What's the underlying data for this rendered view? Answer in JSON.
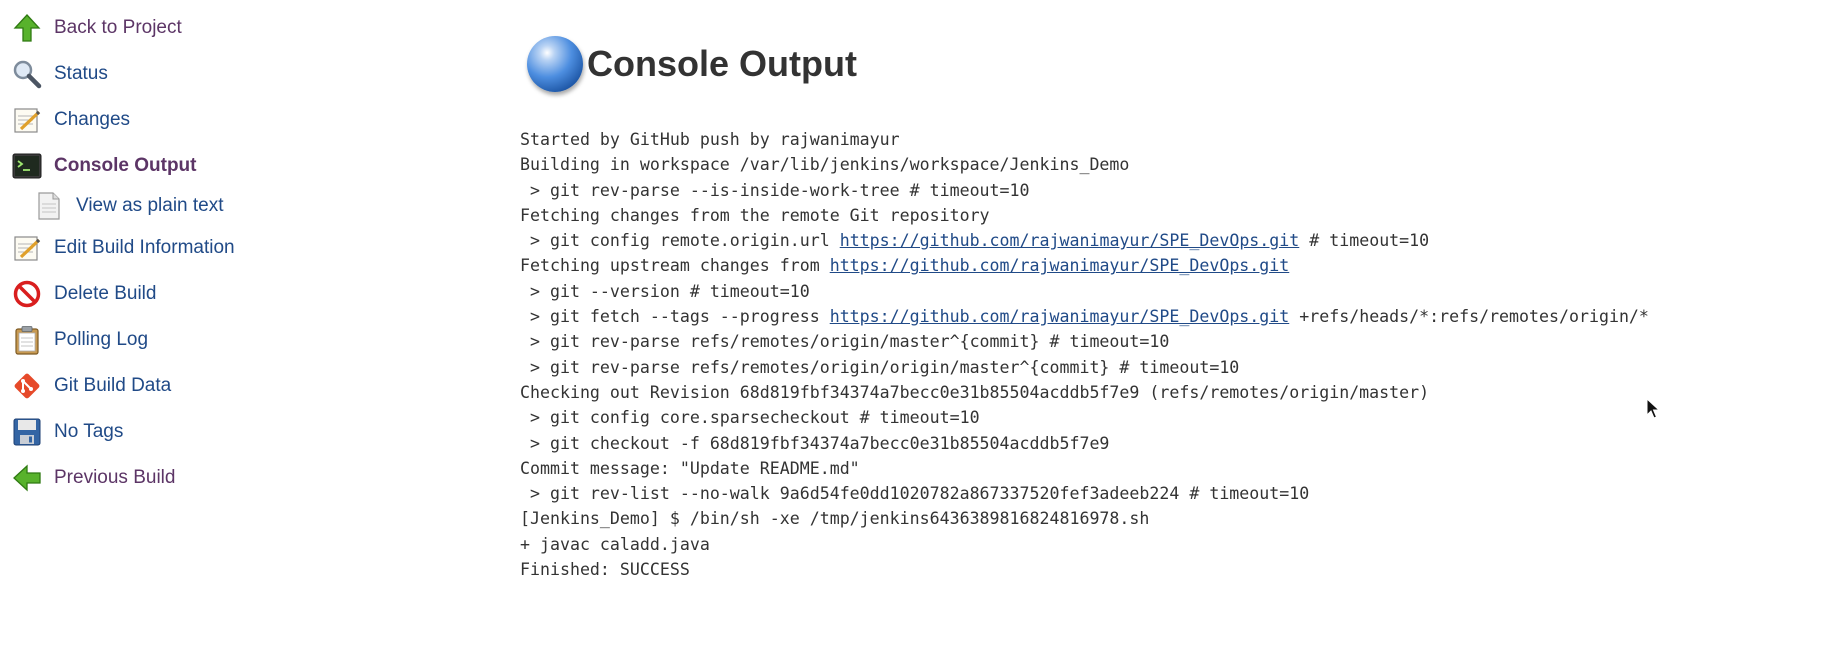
{
  "sidebar": {
    "items": [
      {
        "label": "Back to Project",
        "icon": "up-arrow-icon"
      },
      {
        "label": "Status",
        "icon": "magnifier-icon"
      },
      {
        "label": "Changes",
        "icon": "notepad-icon"
      },
      {
        "label": "Console Output",
        "icon": "terminal-icon"
      },
      {
        "label": "View as plain text",
        "icon": "document-icon"
      },
      {
        "label": "Edit Build Information",
        "icon": "notepad-pencil-icon"
      },
      {
        "label": "Delete Build",
        "icon": "no-entry-icon"
      },
      {
        "label": "Polling Log",
        "icon": "clipboard-icon"
      },
      {
        "label": "Git Build Data",
        "icon": "git-icon"
      },
      {
        "label": "No Tags",
        "icon": "floppy-disk-icon"
      },
      {
        "label": "Previous Build",
        "icon": "left-arrow-icon"
      }
    ]
  },
  "main": {
    "title": "Console Output",
    "title_icon": "globe-icon"
  },
  "console": {
    "lines": [
      "Started by GitHub push by rajwanimayur",
      "Building in workspace /var/lib/jenkins/workspace/Jenkins_Demo",
      " > git rev-parse --is-inside-work-tree # timeout=10",
      "Fetching changes from the remote Git repository",
      {
        "pre": " > git config remote.origin.url ",
        "link": "https://github.com/rajwanimayur/SPE_DevOps.git",
        "post": " # timeout=10"
      },
      {
        "pre": "Fetching upstream changes from ",
        "link": "https://github.com/rajwanimayur/SPE_DevOps.git",
        "post": ""
      },
      " > git --version # timeout=10",
      {
        "pre": " > git fetch --tags --progress ",
        "link": "https://github.com/rajwanimayur/SPE_DevOps.git",
        "post": " +refs/heads/*:refs/remotes/origin/*"
      },
      " > git rev-parse refs/remotes/origin/master^{commit} # timeout=10",
      " > git rev-parse refs/remotes/origin/origin/master^{commit} # timeout=10",
      "Checking out Revision 68d819fbf34374a7becc0e31b85504acddb5f7e9 (refs/remotes/origin/master)",
      " > git config core.sparsecheckout # timeout=10",
      " > git checkout -f 68d819fbf34374a7becc0e31b85504acddb5f7e9",
      "Commit message: \"Update README.md\"",
      " > git rev-list --no-walk 9a6d54fe0dd1020782a867337520fef3adeeb224 # timeout=10",
      "[Jenkins_Demo] $ /bin/sh -xe /tmp/jenkins6436389816824816978.sh",
      "+ javac caladd.java",
      "Finished: SUCCESS"
    ]
  },
  "colors": {
    "link": "#204a87",
    "visited_link": "#5c3566",
    "text": "#333333"
  }
}
